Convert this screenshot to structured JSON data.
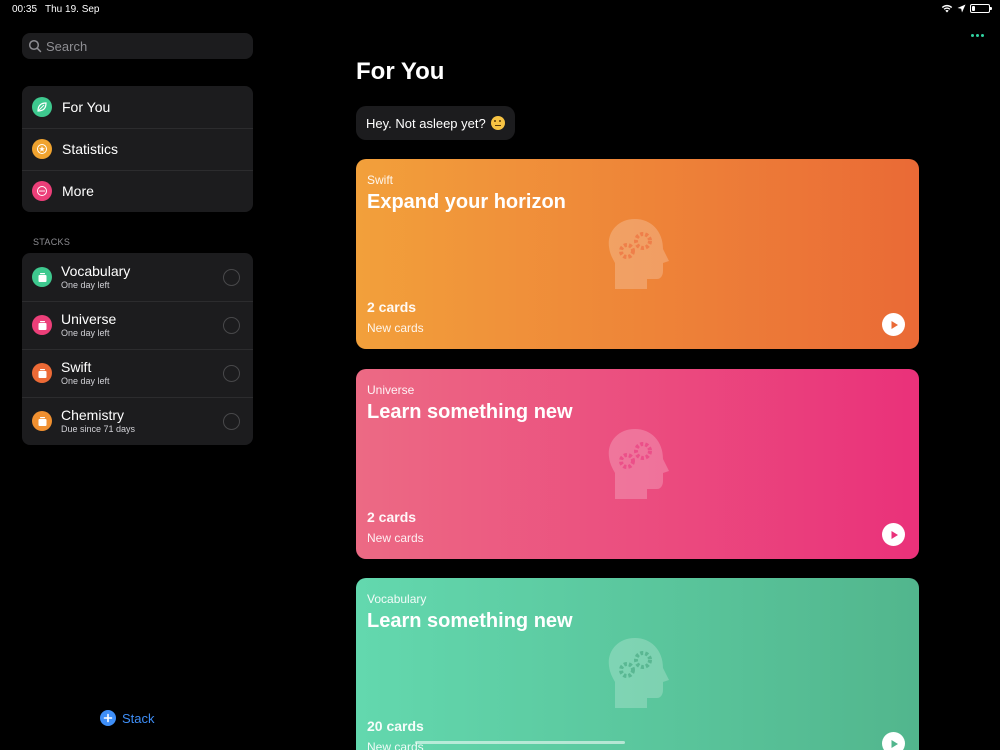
{
  "status_bar": {
    "time": "00:35",
    "date": "Thu 19. Sep",
    "battery_level": 0.2
  },
  "sidebar": {
    "search": {
      "placeholder": "Search"
    },
    "nav_items": [
      {
        "label": "For You",
        "icon": "leaf-icon",
        "color": "#3ec98f"
      },
      {
        "label": "Statistics",
        "icon": "star-icon",
        "color": "#f0a32f"
      },
      {
        "label": "More",
        "icon": "ellipsis-icon",
        "color": "#ec3f79"
      }
    ],
    "stacks_header": "STACKS",
    "stacks": [
      {
        "name": "Vocabulary",
        "sub": "One day left",
        "color": "#3ec98f",
        "icon": "stack-icon"
      },
      {
        "name": "Universe",
        "sub": "One day left",
        "color": "#ec3f79",
        "icon": "stack-icon"
      },
      {
        "name": "Swift",
        "sub": "One day left",
        "color": "#ec6a36",
        "icon": "stack-icon"
      },
      {
        "name": "Chemistry",
        "sub": "Due since 71 days",
        "color": "#f09030",
        "icon": "stack-icon"
      }
    ],
    "add_stack_label": "Stack"
  },
  "main": {
    "title": "For You",
    "greeting": "Hey. Not asleep yet?",
    "greeting_emoji": "thinking-face-icon",
    "cards": [
      {
        "category": "Swift",
        "title": "Expand your horizon",
        "count": "2 cards",
        "sub": "New cards"
      },
      {
        "category": "Universe",
        "title": "Learn something new",
        "count": "2 cards",
        "sub": "New cards"
      },
      {
        "category": "Vocabulary",
        "title": "Learn something new",
        "count": "20 cards",
        "sub": "New cards"
      }
    ]
  },
  "colors": {
    "accent": "#3e8ef7",
    "more_dots": "#30d1a0"
  }
}
